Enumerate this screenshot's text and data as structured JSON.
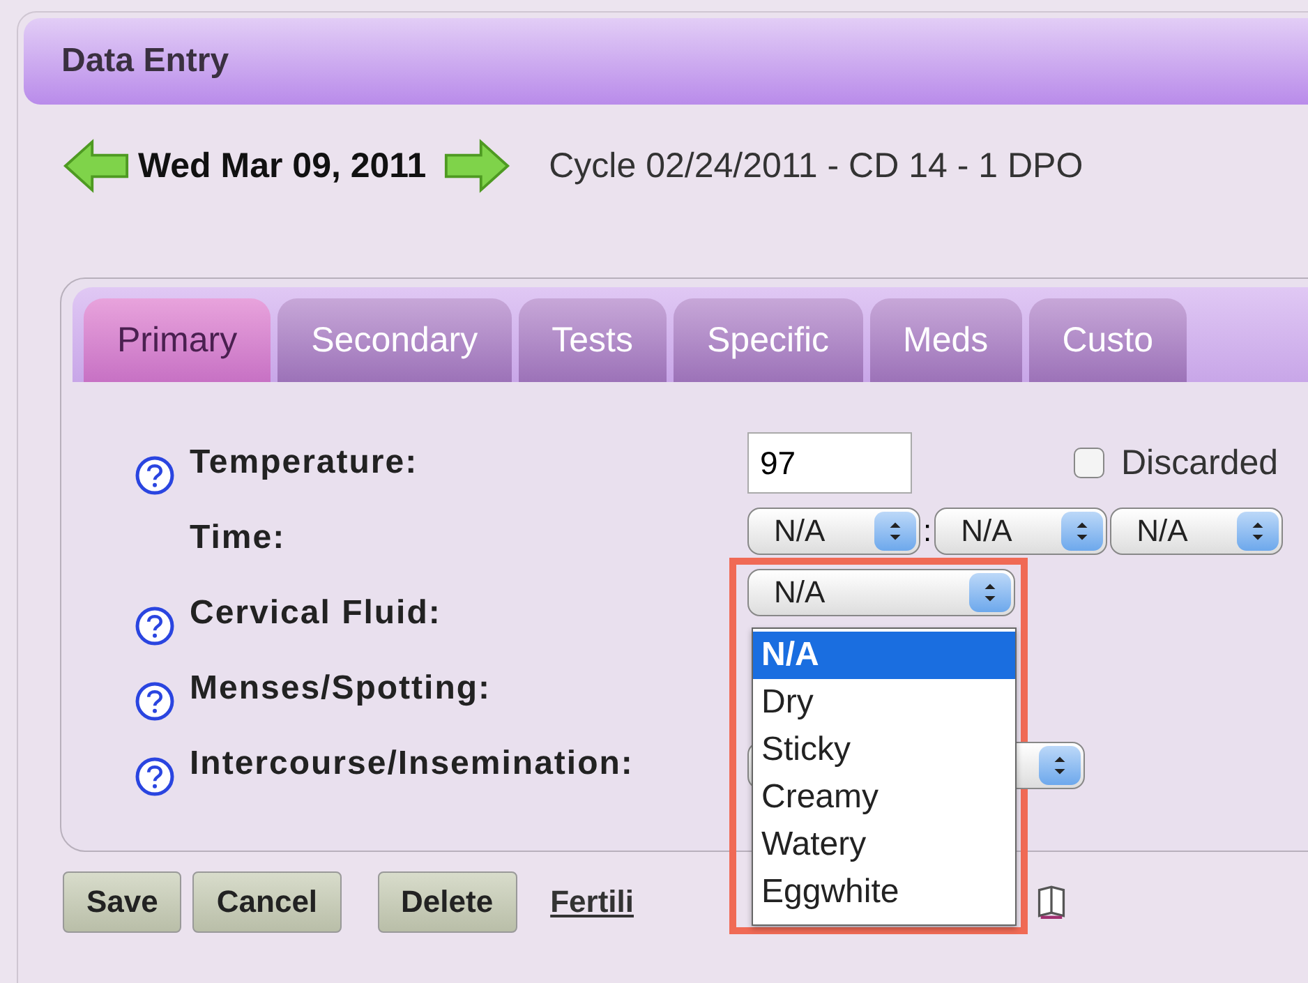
{
  "panel": {
    "title": "Data Entry"
  },
  "date_nav": {
    "date": "Wed Mar 09, 2011",
    "cycle": "Cycle 02/24/2011 - CD 14 - 1 DPO"
  },
  "tabs": [
    {
      "label": "Primary",
      "selected": true
    },
    {
      "label": "Secondary",
      "selected": false
    },
    {
      "label": "Tests",
      "selected": false
    },
    {
      "label": "Specific",
      "selected": false
    },
    {
      "label": "Meds",
      "selected": false
    },
    {
      "label": "Custo",
      "selected": false
    }
  ],
  "fields": [
    {
      "kind": "text",
      "label": "Temperature:",
      "help": true,
      "value": "97",
      "checkbox": {
        "label": "Discarded",
        "checked": false
      }
    },
    {
      "kind": "time",
      "label": "Time:",
      "help": false,
      "separator": ":",
      "selects": [
        "N/A",
        "N/A",
        "N/A"
      ]
    },
    {
      "kind": "dropdown",
      "label": "Cervical Fluid:",
      "help": true,
      "value": "N/A",
      "options": [
        {
          "label": "N/A",
          "selected": true
        },
        {
          "label": "Dry",
          "selected": false
        },
        {
          "label": "Sticky",
          "selected": false
        },
        {
          "label": "Creamy",
          "selected": false
        },
        {
          "label": "Watery",
          "selected": false
        },
        {
          "label": "Eggwhite",
          "selected": false
        }
      ]
    },
    {
      "kind": "covered",
      "label": "Menses/Spotting:",
      "help": true
    },
    {
      "kind": "covered-select",
      "label": "Intercourse/Insemination:",
      "help": true
    }
  ],
  "buttons": [
    "Save",
    "Cancel",
    "Delete"
  ],
  "link": "Fertili"
}
